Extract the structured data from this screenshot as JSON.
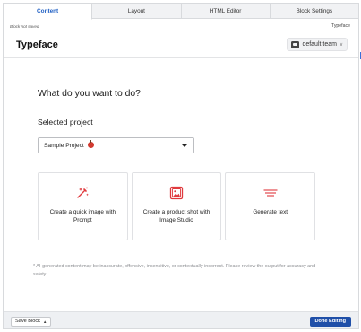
{
  "tabs": [
    {
      "label": "Content",
      "active": true
    },
    {
      "label": "Layout",
      "active": false
    },
    {
      "label": "HTML Editor",
      "active": false
    },
    {
      "label": "Block Settings",
      "active": false
    }
  ],
  "status": {
    "left": "Block not saved",
    "right": "Typeface"
  },
  "header": {
    "title": "Typeface",
    "team_label": "default team"
  },
  "main": {
    "question": "What do you want to do?",
    "selected_project_label": "Selected project",
    "project_value": "Sample Project",
    "cards": [
      {
        "label": "Create a quick image with Prompt",
        "icon": "magic-wand-icon"
      },
      {
        "label": "Create a product shot with Image Studio",
        "icon": "image-icon"
      },
      {
        "label": "Generate text",
        "icon": "text-lines-icon"
      }
    ],
    "disclaimer": "* AI-generated content may be inaccurate, offensive, insensitive, or contextually incorrect. Please review the output for accuracy and safety."
  },
  "footer": {
    "save_label": "Save Block",
    "done_label": "Done Editing"
  },
  "colors": {
    "accent": "#1f5fc4",
    "primary_button": "#1f4fa8",
    "icon_red": "#e03a3e"
  }
}
